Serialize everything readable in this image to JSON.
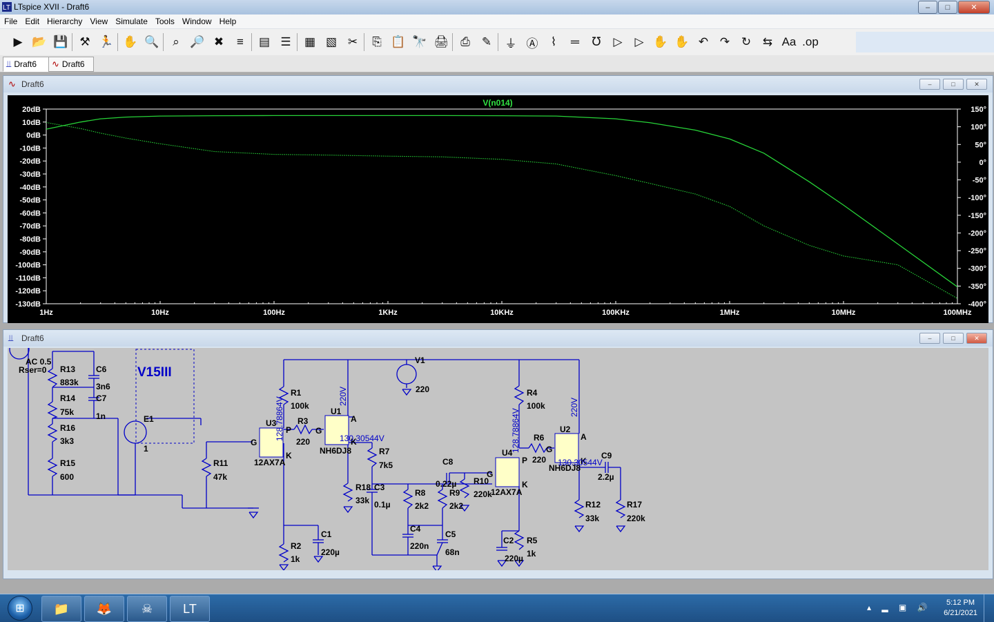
{
  "window": {
    "title": "LTspice XVII - Draft6",
    "min": "–",
    "max": "□",
    "close": "✕"
  },
  "menu": [
    "File",
    "Edit",
    "Hierarchy",
    "View",
    "Simulate",
    "Tools",
    "Window",
    "Help"
  ],
  "toolbar": [
    {
      "name": "new-schematic",
      "g": "▶"
    },
    {
      "name": "open",
      "g": "📂"
    },
    {
      "name": "save",
      "g": "💾"
    },
    {
      "name": "control-panel",
      "g": "⚒"
    },
    {
      "name": "run",
      "g": "🏃"
    },
    {
      "name": "halt",
      "g": "✋"
    },
    {
      "name": "zoom-in",
      "g": "🔍"
    },
    {
      "name": "zoom-area",
      "g": "⌕"
    },
    {
      "name": "zoom-out",
      "g": "🔎"
    },
    {
      "name": "zoom-fit",
      "g": "✖"
    },
    {
      "name": "autorange",
      "g": "≡"
    },
    {
      "name": "fft",
      "g": "▤"
    },
    {
      "name": "tile-horizontal",
      "g": "☰"
    },
    {
      "name": "tile-vertical",
      "g": "▦"
    },
    {
      "name": "cascade",
      "g": "▧"
    },
    {
      "name": "cut",
      "g": "✂"
    },
    {
      "name": "copy",
      "g": "⎘"
    },
    {
      "name": "paste",
      "g": "📋"
    },
    {
      "name": "find",
      "g": "🔭"
    },
    {
      "name": "print",
      "g": "🖨"
    },
    {
      "name": "print-setup",
      "g": "⎙"
    },
    {
      "name": "draw-wire",
      "g": "✎"
    },
    {
      "name": "ground",
      "g": "⏚"
    },
    {
      "name": "label-net",
      "g": "Ⓐ"
    },
    {
      "name": "resistor",
      "g": "⌇"
    },
    {
      "name": "capacitor",
      "g": "═"
    },
    {
      "name": "inductor",
      "g": "℧"
    },
    {
      "name": "diode",
      "g": "▷"
    },
    {
      "name": "component",
      "g": "▷"
    },
    {
      "name": "move",
      "g": "✋"
    },
    {
      "name": "drag",
      "g": "✋"
    },
    {
      "name": "undo",
      "g": "↶"
    },
    {
      "name": "redo",
      "g": "↷"
    },
    {
      "name": "rotate",
      "g": "↻"
    },
    {
      "name": "mirror",
      "g": "⇆"
    },
    {
      "name": "text",
      "g": "Aa"
    },
    {
      "name": "spice-directive",
      "g": ".op"
    }
  ],
  "tabs": [
    {
      "label": "Draft6"
    },
    {
      "label": "Draft6"
    }
  ],
  "plot": {
    "title": "Draft6",
    "chart_data": {
      "type": "line",
      "title": "V(n014)",
      "x_scale": "log",
      "xlim": [
        1,
        100000000
      ],
      "x_ticks": [
        "1Hz",
        "10Hz",
        "100Hz",
        "1KHz",
        "10KHz",
        "100KHz",
        "1MHz",
        "10MHz",
        "100MHz"
      ],
      "y_ticks_left": [
        "20dB",
        "10dB",
        "0dB",
        "-10dB",
        "-20dB",
        "-30dB",
        "-40dB",
        "-50dB",
        "-60dB",
        "-70dB",
        "-80dB",
        "-90dB",
        "-100dB",
        "-110dB",
        "-120dB",
        "-130dB"
      ],
      "ylim_left": [
        -130,
        20
      ],
      "y_ticks_right": [
        "150°",
        "100°",
        "50°",
        "0°",
        "-50°",
        "-100°",
        "-150°",
        "-200°",
        "-250°",
        "-300°",
        "-350°",
        "-400°"
      ],
      "ylim_right": [
        -400,
        150
      ],
      "series": [
        {
          "x": [
            1,
            2,
            3,
            5,
            10,
            30,
            100,
            300,
            1000,
            3000,
            10000,
            30000,
            100000,
            200000,
            500000,
            1000000,
            2000000,
            5000000,
            10000000,
            30000000,
            100000000
          ],
          "values": [
            4.5,
            10,
            12.5,
            13.8,
            14.6,
            14.9,
            15,
            15,
            15,
            15,
            14.9,
            14.6,
            12.5,
            9.5,
            3.8,
            -3,
            -14,
            -36,
            -54,
            -84,
            -117
          ]
        },
        {
          "x": [
            1,
            2,
            3,
            5,
            10,
            30,
            100,
            300,
            1000,
            3000,
            10000,
            30000,
            100000,
            200000,
            500000,
            1000000,
            2000000,
            5000000,
            10000000,
            30000000,
            100000000
          ],
          "values": [
            112,
            95,
            82,
            68,
            52,
            30,
            22,
            20,
            17,
            15,
            8,
            -5,
            -38,
            -60,
            -90,
            -125,
            -180,
            -235,
            -265,
            -290,
            -385
          ]
        }
      ],
      "grid": false,
      "colors": {
        "series": "#27d338",
        "background": "#000000",
        "axes": "#ffffff",
        "title": "#32e343"
      }
    }
  },
  "schematic": {
    "title": "Draft6",
    "labels": {
      "src1": "AC 0.5",
      "src2": "Rser=0",
      "r13": "R13",
      "r13v": "883k",
      "c6": "C6",
      "c6v": "3n6",
      "r14": "R14",
      "r14v": "75k",
      "c7": "C7",
      "c7v": "1n",
      "r16": "R16",
      "r16v": "3k3",
      "r15": "R15",
      "r15v": "600",
      "box": "V15III",
      "e1": "E1",
      "e1n": "1",
      "r11": "R11",
      "r11v": "47k",
      "u3": "U3",
      "u3t": "12AX7A",
      "u3p": "P",
      "u3g": "G",
      "u3k": "K",
      "u3v": "128.78864V",
      "r1": "R1",
      "r1v": "100k",
      "r3": "R3",
      "r3v": "220",
      "r3g": "G",
      "u1": "U1",
      "u1t": "NH6DJ8",
      "u1a": "A",
      "u1k": "K",
      "u1v": "130.30544V",
      "u1n": "220V",
      "v1": "V1",
      "v1v": "220",
      "r7": "R7",
      "r7v": "7k5",
      "r18": "R18",
      "r18v": "33k",
      "c3": "C3",
      "c3v": "0.1µ",
      "r8": "R8",
      "r8v": "2k2",
      "r9": "R9",
      "r9v": "2k2",
      "c8": "C8",
      "c8v": "0.22µ",
      "r10": "R10",
      "r10v": "220k",
      "c4": "C4",
      "c4v": "220n",
      "c5": "C5",
      "c5v": "68n",
      "r2": "R2",
      "r2v": "1k",
      "c1": "C1",
      "c1v": "220µ",
      "u4": "U4",
      "u4t": "12AX7A",
      "u4p": "P",
      "u4g": "G",
      "u4k": "K",
      "u4v": "128.78864V",
      "r4": "R4",
      "r4v": "100k",
      "r6": "R6",
      "r6v": "220",
      "u2": "U2",
      "u2t": "NH6DJ8",
      "u2a": "A",
      "u2k": "K",
      "u2v": "130.30544V",
      "u2n": "220V",
      "c9": "C9",
      "c9v": "2.2µ",
      "r12": "R12",
      "r12v": "33k",
      "r17": "R17",
      "r17v": "220k",
      "c2": "C2",
      "c2v": "220µ",
      "r5": "R5",
      "r5v": "1k"
    }
  },
  "taskbar": {
    "apps": [
      {
        "name": "file-explorer",
        "g": "📁"
      },
      {
        "name": "firefox",
        "g": "🦊"
      },
      {
        "name": "acrobat",
        "g": "☠"
      },
      {
        "name": "ltspice",
        "g": "LT"
      }
    ],
    "time": "5:12 PM",
    "date": "6/21/2021",
    "tray": "▴ ▂ ▣ 🔊"
  }
}
